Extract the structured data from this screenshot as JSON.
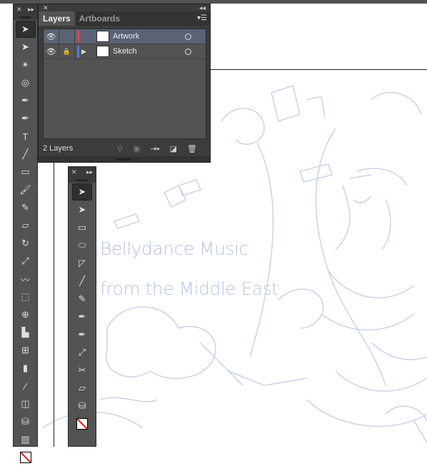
{
  "layers_panel": {
    "tabs": [
      {
        "label": "Layers",
        "active": true
      },
      {
        "label": "Artboards",
        "active": false
      }
    ],
    "layers": [
      {
        "name": "Artwork",
        "color": "#e0464b",
        "visible": true,
        "locked": false,
        "selected": true
      },
      {
        "name": "Sketch",
        "color": "#4f7ae0",
        "visible": true,
        "locked": true,
        "selected": false
      }
    ],
    "count_label": "2 Layers"
  },
  "canvas": {
    "sketch_text": [
      "Bellydance Music",
      "from the Middle East"
    ]
  },
  "toolbar_main": [
    "selection",
    "direct-selection",
    "magic-wand",
    "lasso",
    "pen",
    "curvature",
    "type",
    "line",
    "rectangle",
    "paintbrush",
    "pencil",
    "eraser",
    "rotate",
    "scale",
    "warp",
    "free-transform",
    "shape-builder",
    "graph",
    "mesh",
    "gradient",
    "eyedropper",
    "blend",
    "symbol-sprayer",
    "column-graph"
  ],
  "toolbar_float": [
    "selection",
    "direct-selection",
    "rectangle",
    "ellipse",
    "direct-select-arrow",
    "line",
    "pencil",
    "pen",
    "add-anchor",
    "scale",
    "scissors",
    "eraser",
    "symbol-sprayer"
  ]
}
